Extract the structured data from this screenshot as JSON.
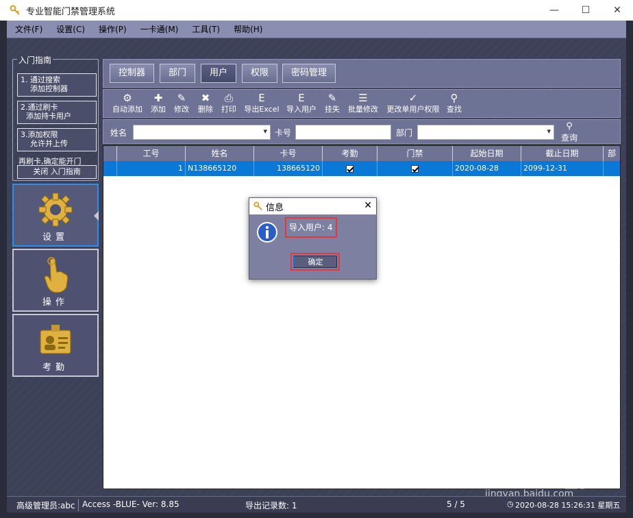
{
  "window": {
    "title": "专业智能门禁管理系统",
    "minimize": "—",
    "maximize": "☐",
    "close": "✕"
  },
  "menu": [
    "文件(F)",
    "设置(C)",
    "操作(P)",
    "一卡通(M)",
    "工具(T)",
    "帮助(H)"
  ],
  "guide": {
    "title": "入门指南",
    "step1_a": "1.  通过搜索",
    "step1_b": "添加控制器",
    "step2_a": "2.通过刷卡",
    "step2_b": "添加持卡用户",
    "step3_a": "3.添加权限",
    "step3_b": "允许并上传",
    "note": "再刷卡,确定能开门",
    "close": "关闭 入门指南"
  },
  "sidebar": [
    {
      "label": "设置",
      "icon": "gear-icon",
      "active": true
    },
    {
      "label": "操作",
      "icon": "hand-pointer-icon",
      "active": false
    },
    {
      "label": "考勤",
      "icon": "id-card-icon",
      "active": false
    }
  ],
  "tabs": [
    "控制器",
    "部门",
    "用户",
    "权限",
    "密码管理"
  ],
  "active_tab": "用户",
  "toolbar": [
    {
      "label": "自动添加",
      "icon": "auto-add-icon",
      "glyph": "⚙"
    },
    {
      "label": "添加",
      "icon": "plus-icon",
      "glyph": "✚"
    },
    {
      "label": "修改",
      "icon": "pencil-icon",
      "glyph": "✎"
    },
    {
      "label": "删除",
      "icon": "delete-x-icon",
      "glyph": "✖"
    },
    {
      "label": "打印",
      "icon": "printer-icon",
      "glyph": "⎙"
    },
    {
      "label": "导出Excel",
      "icon": "export-excel-icon",
      "glyph": "E"
    },
    {
      "label": "导入用户",
      "icon": "import-user-icon",
      "glyph": "E"
    },
    {
      "label": "挂失",
      "icon": "report-loss-icon",
      "glyph": "✎"
    },
    {
      "label": "批量修改",
      "icon": "batch-edit-icon",
      "glyph": "☰"
    },
    {
      "label": "更改单用户权限",
      "icon": "user-permission-icon",
      "glyph": "✓"
    },
    {
      "label": "查找",
      "icon": "search-icon",
      "glyph": "⚲"
    }
  ],
  "filter": {
    "name_label": "姓名",
    "name_value": "",
    "card_label": "卡号",
    "card_value": "",
    "dept_label": "部门",
    "dept_value": "",
    "query_label": "查询"
  },
  "grid": {
    "columns": [
      "工号",
      "姓名",
      "卡号",
      "考勤",
      "门禁",
      "起始日期",
      "截止日期",
      "部"
    ],
    "rows": [
      {
        "id": "1",
        "name": "N138665120",
        "card": "138665120",
        "attendance": true,
        "access": true,
        "start": "2020-08-28",
        "end": "2099-12-31"
      }
    ]
  },
  "dialog": {
    "title": "信息",
    "message": "导入用户: 4",
    "ok": "确定",
    "close": "✕"
  },
  "status": {
    "user": "高级管理员:abc",
    "db": "Access -BLUE- Ver: 8.85",
    "export_count": "导出记录数: 1",
    "page": "5 / 5",
    "datetime": "2020-08-28 15:26:31 星期五"
  },
  "watermark": {
    "brand": "Bai du 经验",
    "url": "jingyan.baidu.com"
  },
  "colors": {
    "panel": "#6e7294",
    "selection": "#0a78d6",
    "highlight": "#e23a3a"
  }
}
